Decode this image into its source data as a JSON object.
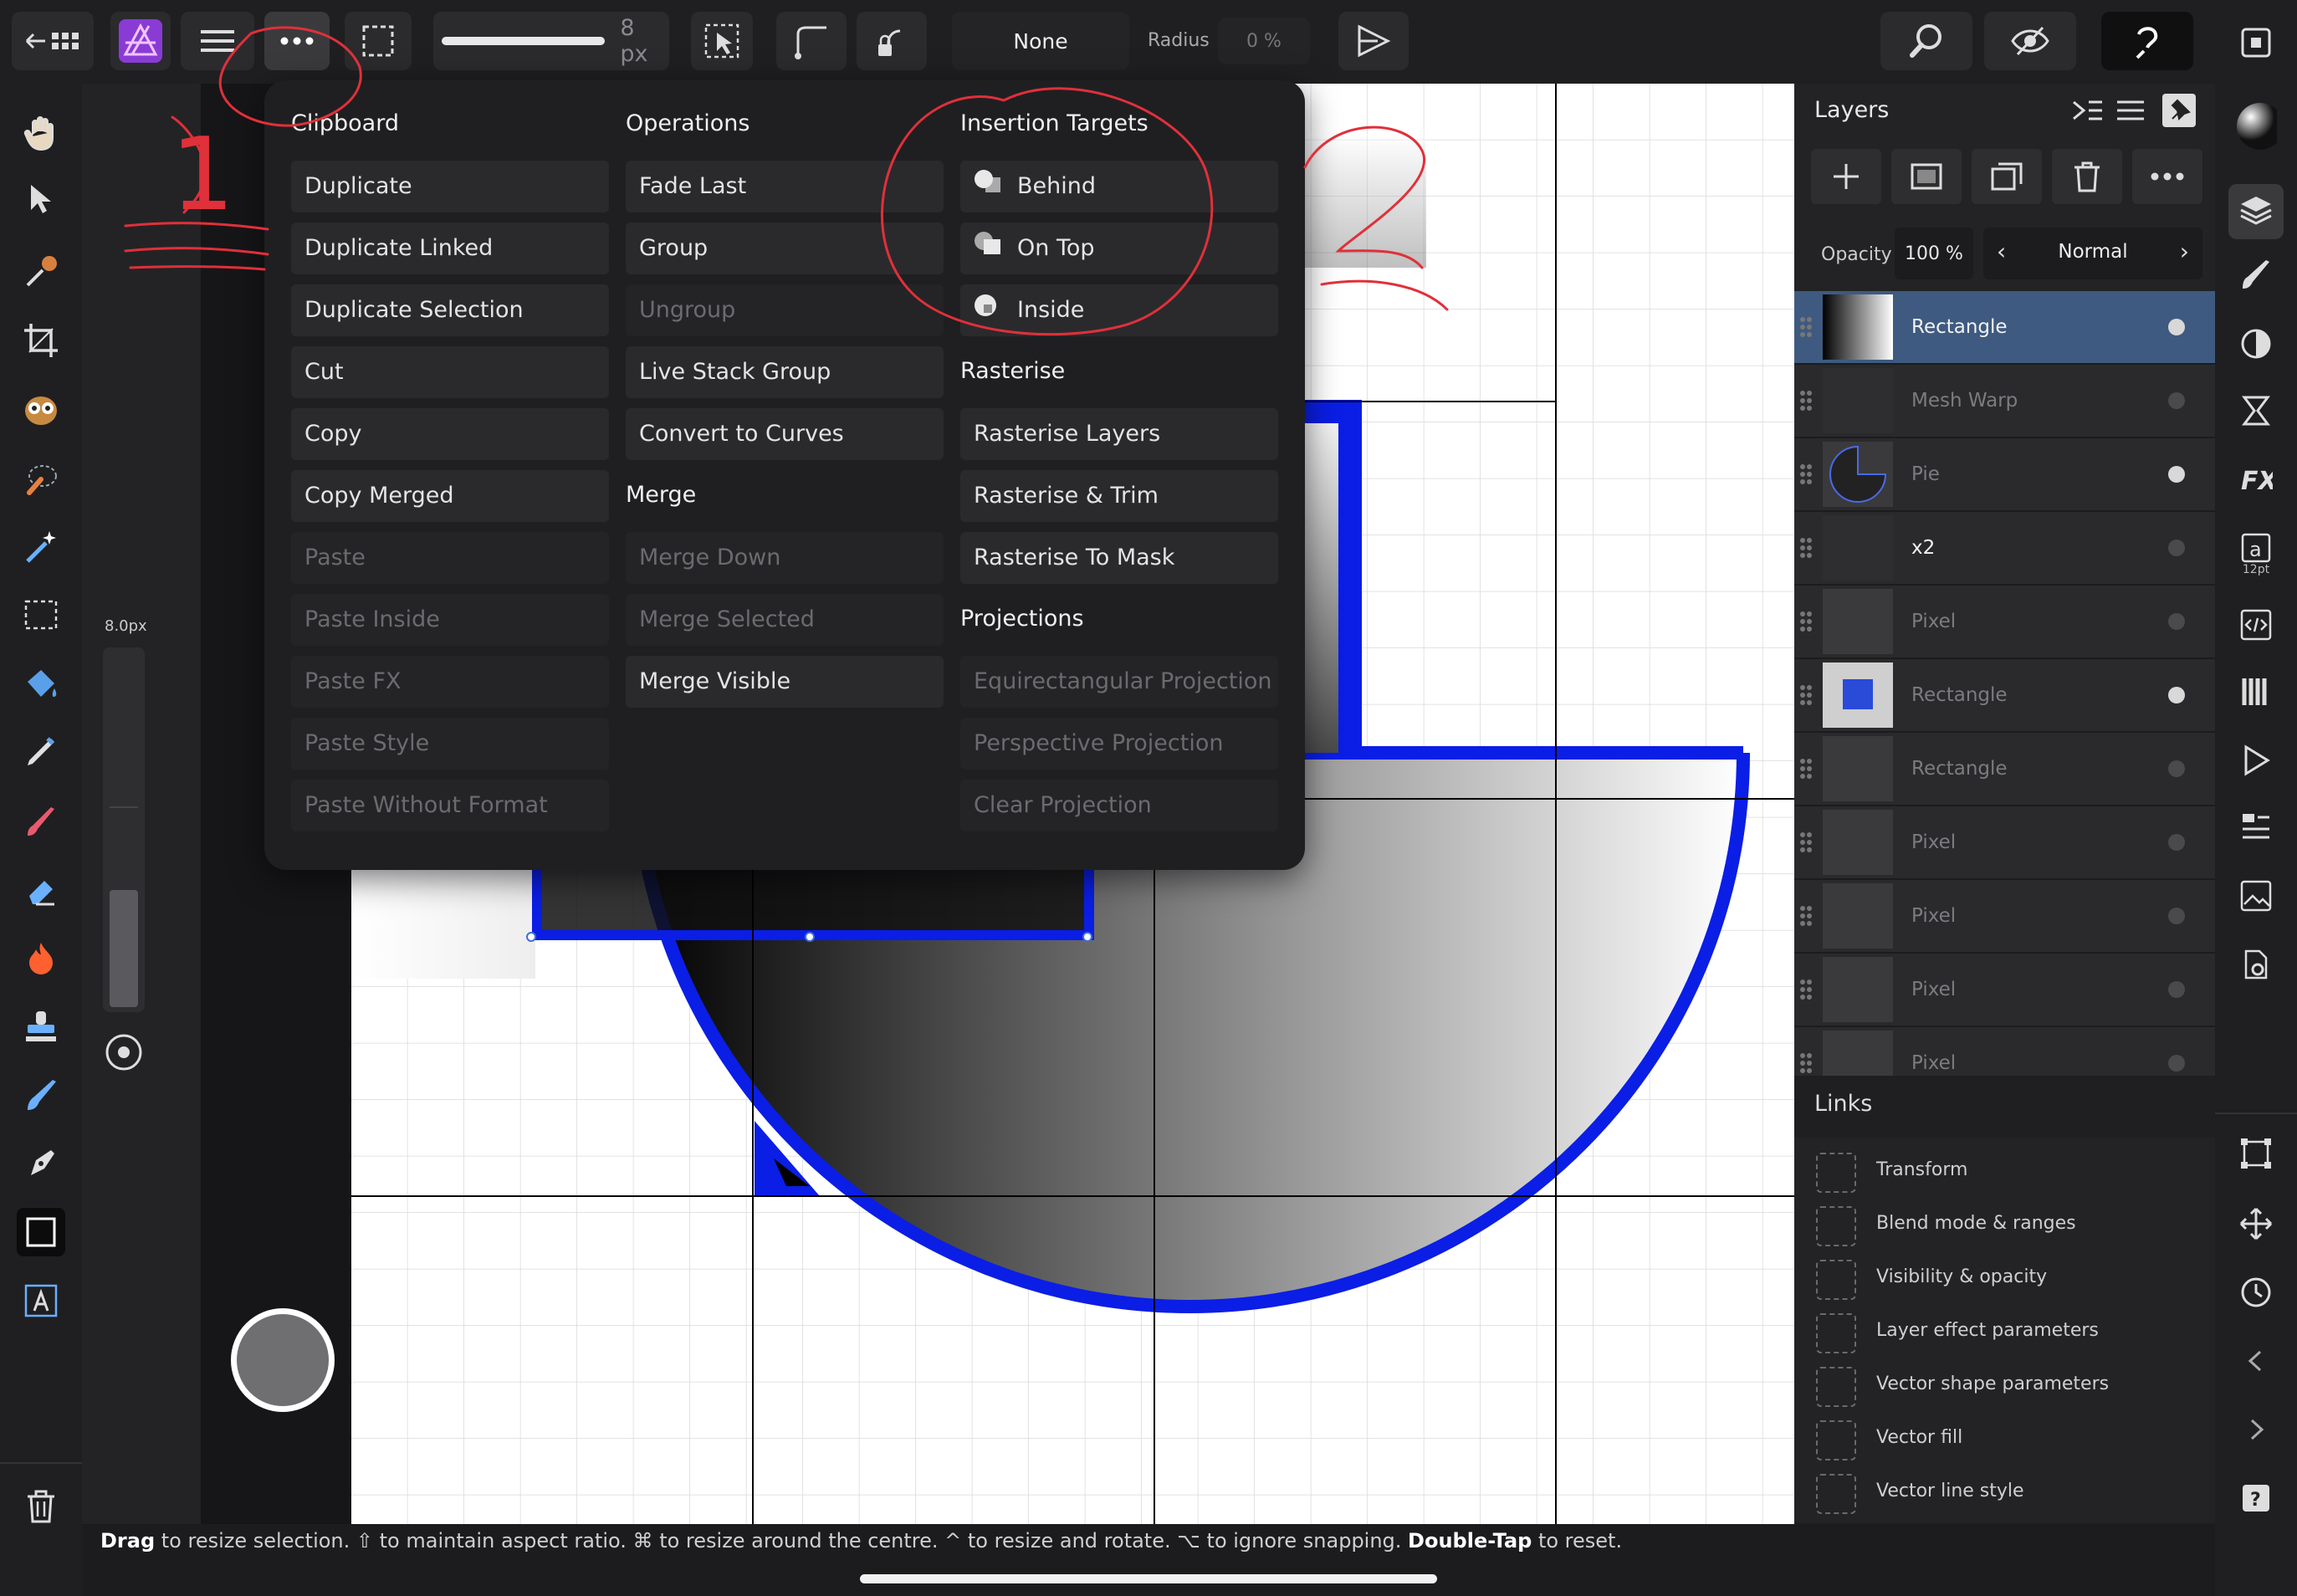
{
  "toolbar": {
    "brush_size": "8 px",
    "corner_type": "None",
    "radius_label": "Radius",
    "radius_value": "0 %"
  },
  "context": {
    "size_label": "8.0px"
  },
  "menu": {
    "clipboard": {
      "title": "Clipboard",
      "items": [
        {
          "label": "Duplicate",
          "enabled": true
        },
        {
          "label": "Duplicate Linked",
          "enabled": true
        },
        {
          "label": "Duplicate Selection",
          "enabled": true
        },
        {
          "label": "Cut",
          "enabled": true
        },
        {
          "label": "Copy",
          "enabled": true
        },
        {
          "label": "Copy Merged",
          "enabled": true
        },
        {
          "label": "Paste",
          "enabled": false
        },
        {
          "label": "Paste Inside",
          "enabled": false
        },
        {
          "label": "Paste FX",
          "enabled": false
        },
        {
          "label": "Paste Style",
          "enabled": false
        },
        {
          "label": "Paste Without Format",
          "enabled": false
        }
      ]
    },
    "operations": {
      "title": "Operations",
      "items": [
        {
          "label": "Fade Last",
          "enabled": true
        },
        {
          "label": "Group",
          "enabled": true
        },
        {
          "label": "Ungroup",
          "enabled": false
        },
        {
          "label": "Live Stack Group",
          "enabled": true
        },
        {
          "label": "Convert to Curves",
          "enabled": true
        }
      ]
    },
    "merge": {
      "title": "Merge",
      "items": [
        {
          "label": "Merge Down",
          "enabled": false
        },
        {
          "label": "Merge Selected",
          "enabled": false
        },
        {
          "label": "Merge Visible",
          "enabled": true
        }
      ]
    },
    "insertion": {
      "title": "Insertion Targets",
      "items": [
        {
          "label": "Behind",
          "enabled": true
        },
        {
          "label": "On Top",
          "enabled": true
        },
        {
          "label": "Inside",
          "enabled": true
        }
      ]
    },
    "rasterise": {
      "title": "Rasterise",
      "items": [
        {
          "label": "Rasterise Layers",
          "enabled": true
        },
        {
          "label": "Rasterise & Trim",
          "enabled": true
        },
        {
          "label": "Rasterise To Mask",
          "enabled": true
        }
      ]
    },
    "projections": {
      "title": "Projections",
      "items": [
        {
          "label": "Equirectangular Projection",
          "enabled": false
        },
        {
          "label": "Perspective Projection",
          "enabled": false
        },
        {
          "label": "Clear Projection",
          "enabled": false
        }
      ]
    }
  },
  "layers_panel": {
    "title": "Layers",
    "opacity_label": "Opacity",
    "opacity_value": "100 %",
    "blend_mode": "Normal",
    "layers": [
      {
        "name": "Rectangle",
        "selected": true,
        "visible": true
      },
      {
        "name": "Mesh Warp",
        "selected": false,
        "visible": false
      },
      {
        "name": "Pie",
        "selected": false,
        "visible": true
      },
      {
        "name": "x2",
        "selected": false,
        "visible": false
      },
      {
        "name": "Pixel",
        "selected": false,
        "visible": false
      },
      {
        "name": "Rectangle",
        "selected": false,
        "visible": true
      },
      {
        "name": "Rectangle",
        "selected": false,
        "visible": false
      },
      {
        "name": "Pixel",
        "selected": false,
        "visible": false
      },
      {
        "name": "Pixel",
        "selected": false,
        "visible": false
      },
      {
        "name": "Pixel",
        "selected": false,
        "visible": false
      },
      {
        "name": "Pixel",
        "selected": false,
        "visible": false
      }
    ]
  },
  "links_panel": {
    "title": "Links",
    "items": [
      "Transform",
      "Blend mode & ranges",
      "Visibility & opacity",
      "Layer effect parameters",
      "Vector shape parameters",
      "Vector fill",
      "Vector line style"
    ]
  },
  "right_strip": {
    "text_size_label": "12pt"
  },
  "annotations": {
    "note_1": "1",
    "note_2": "2"
  },
  "status": {
    "drag": "Drag",
    "t1": " to resize selection. ⇧ to maintain aspect ratio. ⌘ to resize around the centre. ^ to resize and rotate. ⌥ to ignore snapping. ",
    "dbl": "Double-Tap",
    "t2": " to reset."
  },
  "colors": {
    "shape_stroke": "#0a1ee6",
    "selection": "#3e5a80",
    "annotation": "#e0303a"
  }
}
